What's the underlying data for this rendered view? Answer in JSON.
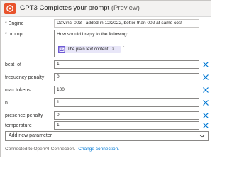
{
  "header": {
    "title": "GPT3 Completes your prompt",
    "subtitle": "(Preview)",
    "icon": "openai-app-icon",
    "accent": "#e8532c"
  },
  "fields": {
    "engine": {
      "label": "* Engine",
      "value": "DaVinci 003 - added in 12/2022, better than 002 at same cost"
    },
    "prompt": {
      "label": "* prompt",
      "text": "How should I reply to the following:",
      "token_label": "The plain text content.",
      "trailing": "\""
    },
    "best_of": {
      "label": "best_of",
      "value": "1"
    },
    "frequency_penalty": {
      "label": "frequency penalty",
      "value": "0"
    },
    "max_tokens": {
      "label": "max tokens",
      "value": "100"
    },
    "n": {
      "label": "n",
      "value": "1"
    },
    "presence_penalty": {
      "label": "presence penalty",
      "value": "0"
    },
    "temperature": {
      "label": "temperature",
      "value": "1"
    }
  },
  "add_parameter": {
    "label": "Add new parameter"
  },
  "footer": {
    "connected_text": "Connected to OpenAI-Connection.",
    "change_link": "Change connection."
  },
  "colors": {
    "clear_icon": "#0078d4",
    "token_bg": "#e8e6f8",
    "token_icon": "#6e5ad4"
  }
}
